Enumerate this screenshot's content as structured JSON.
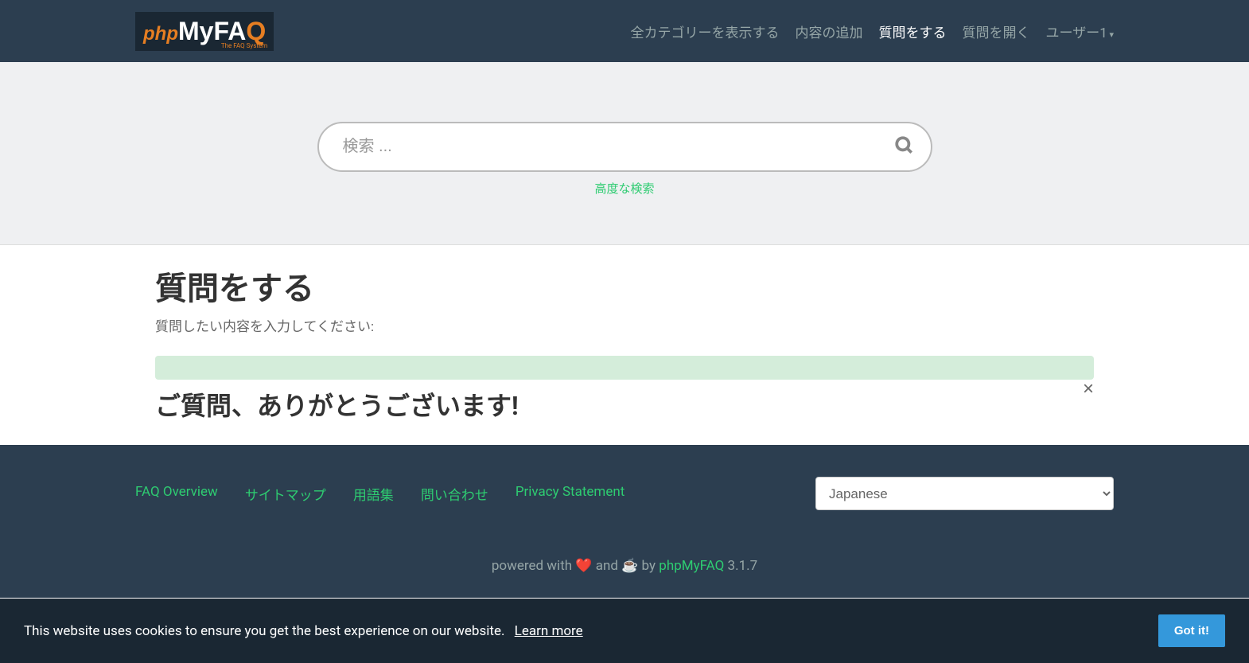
{
  "nav": {
    "items": [
      {
        "label": "全カテゴリーを表示する",
        "active": false
      },
      {
        "label": "内容の追加",
        "active": false
      },
      {
        "label": "質問をする",
        "active": true
      },
      {
        "label": "質問を開く",
        "active": false
      }
    ],
    "user": "ユーザー1"
  },
  "search": {
    "placeholder": "検索 ...",
    "advanced": "高度な検索"
  },
  "page": {
    "title": "質問をする",
    "subtitle": "質問したい内容を入力してください:",
    "thank_you": "ご質問、ありがとうございます!"
  },
  "footer": {
    "links": [
      "FAQ Overview",
      "サイトマップ",
      "用語集",
      "問い合わせ",
      "Privacy Statement"
    ],
    "language": "Japanese",
    "powered_prefix": "powered with ",
    "heart": "❤️",
    "and": " and ",
    "coffee": "☕",
    "by": " by ",
    "brand": "phpMyFAQ",
    "version": " 3.1.7"
  },
  "cookie": {
    "text": "This website uses cookies to ensure you get the best experience on our website.",
    "learn_more": "Learn more",
    "button": "Got it!"
  }
}
